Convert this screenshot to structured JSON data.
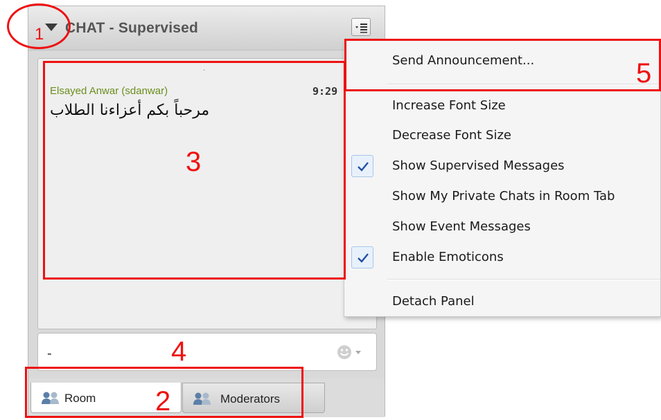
{
  "panel": {
    "title": "CHAT - Supervised",
    "collapse_icon": "triangle-down",
    "options_icon": "menu-list-icon"
  },
  "messages": {
    "dot": ".",
    "items": [
      {
        "sender": "Elsayed Anwar (sdanwar)",
        "time": "9:29",
        "text": "مرحباً بكم أعزاءنا الطلاب"
      }
    ]
  },
  "input": {
    "value": "-",
    "emoticon_icon": "smiley-icon"
  },
  "tabs": [
    {
      "label": "Room",
      "icon": "users-icon",
      "active": true
    },
    {
      "label": "Moderators",
      "icon": "users-icon",
      "active": false
    }
  ],
  "menu": {
    "items": [
      {
        "label": "Send Announcement...",
        "checked": false
      },
      {
        "label": "Increase Font Size",
        "checked": false
      },
      {
        "label": "Decrease Font Size",
        "checked": false
      },
      {
        "label": "Show Supervised Messages",
        "checked": true
      },
      {
        "label": "Show My Private Chats in Room Tab",
        "checked": false
      },
      {
        "label": "Show Event Messages",
        "checked": false
      },
      {
        "label": "Enable Emoticons",
        "checked": true
      },
      {
        "label": "Detach Panel",
        "checked": false
      }
    ]
  },
  "annotations": [
    "1",
    "2",
    "3",
    "4",
    "5"
  ],
  "colors": {
    "annotation": "#ee1111",
    "sender": "#6a8e1e",
    "check": "#1f4fa8"
  }
}
